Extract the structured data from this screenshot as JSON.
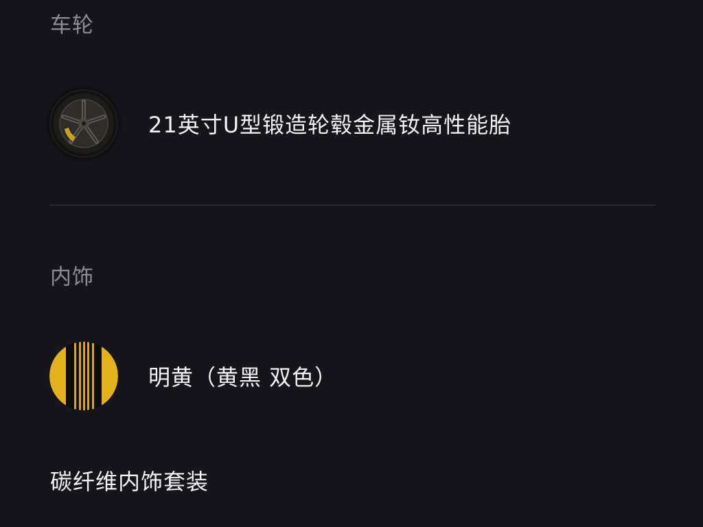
{
  "sections": {
    "wheels": {
      "title": "车轮",
      "option": {
        "label": "21英寸U型锻造轮毂金属钕高性能胎",
        "icon": "forged-wheel-thumbnail"
      }
    },
    "interior": {
      "title": "内饰",
      "option": {
        "label": "明黄（黄黑 双色）",
        "icon": "yellow-black-interior-swatch"
      },
      "package_label": "碳纤维内饰套装"
    }
  },
  "colors": {
    "background": "#16151c",
    "section_title": "#8e8d95",
    "text": "#f4f4f6",
    "divider": "#2a2929",
    "accent_yellow": "#e3b11c"
  }
}
